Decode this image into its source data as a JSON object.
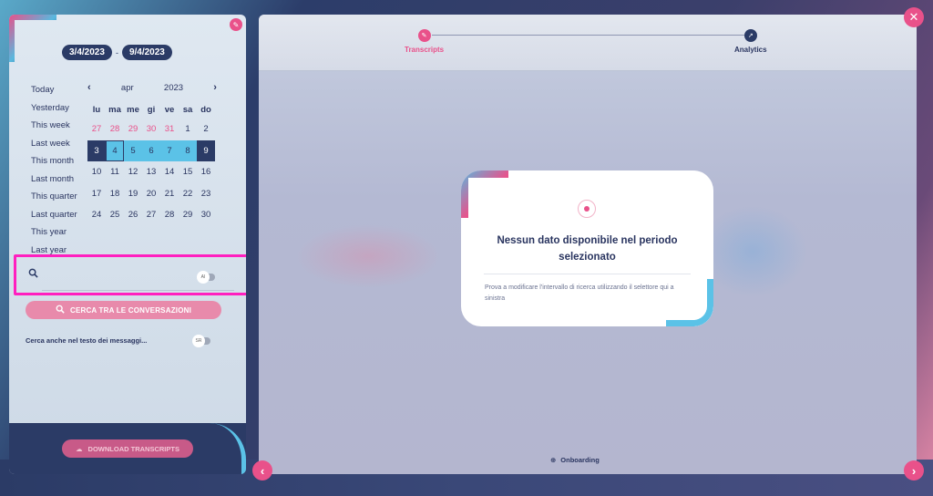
{
  "date_range": {
    "start": "3/4/2023",
    "separator": "-",
    "end": "9/4/2023"
  },
  "presets": [
    "Today",
    "Yesterday",
    "This week",
    "Last week",
    "This month",
    "Last month",
    "This quarter",
    "Last quarter",
    "This year",
    "Last year"
  ],
  "calendar": {
    "prev": "‹",
    "month": "apr",
    "year": "2023",
    "next": "›",
    "weekdays": [
      "lu",
      "ma",
      "me",
      "gi",
      "ve",
      "sa",
      "do"
    ],
    "weeks": [
      [
        "27",
        "28",
        "29",
        "30",
        "31",
        "1",
        "2"
      ],
      [
        "3",
        "4",
        "5",
        "6",
        "7",
        "8",
        "9"
      ],
      [
        "10",
        "11",
        "12",
        "13",
        "14",
        "15",
        "16"
      ],
      [
        "17",
        "18",
        "19",
        "20",
        "21",
        "22",
        "23"
      ],
      [
        "24",
        "25",
        "26",
        "27",
        "28",
        "29",
        "30"
      ]
    ]
  },
  "search": {
    "placeholder": "",
    "toggle_label": "AI"
  },
  "cerca_button": "CERCA TRA LE CONVERSAZIONI",
  "also_text": {
    "label": "Cerca anche nel testo dei messaggi...",
    "toggle_label": "SR"
  },
  "download_button": "DOWNLOAD TRANSCRIPTS",
  "steps": {
    "transcripts": "Transcripts",
    "analytics": "Analytics"
  },
  "empty_state": {
    "title": "Nessun dato disponibile nel periodo selezionato",
    "description": "Prova a modificare l'intervallo di ricerca utilizzando il selettore qui a sinistra"
  },
  "footer": {
    "onboarding": "Onboarding"
  },
  "icons": {
    "edit": "✎",
    "search": "🔍",
    "close": "✕",
    "prev": "‹",
    "next": "›",
    "globe": "⊕",
    "cloud_download": "☁",
    "analytics": "↗"
  },
  "colors": {
    "accent": "#e9518a",
    "navy": "#2b3b66",
    "range": "#5bc2e7",
    "highlight": "#ff1fbf"
  }
}
